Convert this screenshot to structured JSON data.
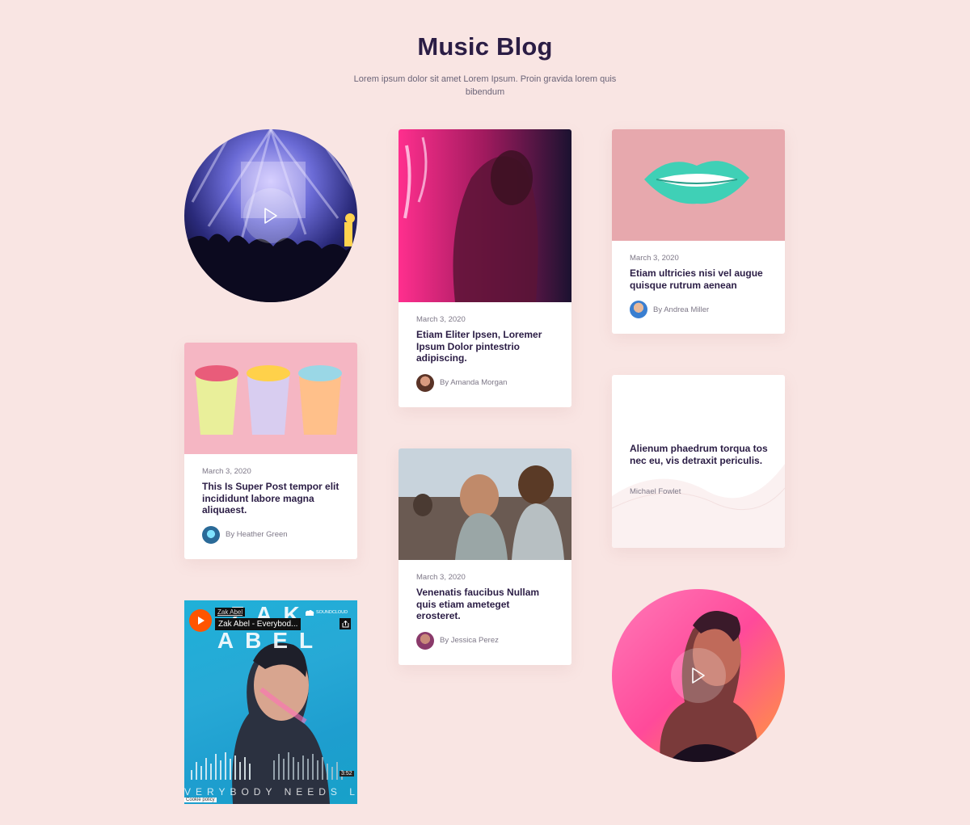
{
  "header": {
    "title": "Music Blog",
    "subtitle": "Lorem ipsum dolor sit amet Lorem Ipsum. Proin gravida lorem quis bibendum"
  },
  "posts": [
    {
      "date": "March 3, 2020",
      "title": "Etiam Eliter Ipsen, Loremer Ipsum Dolor pintestrio adipiscing.",
      "author": "By Amanda Morgan"
    },
    {
      "date": "March 3, 2020",
      "title": "Etiam ultricies nisi vel augue quisque rutrum aenean",
      "author": "By Andrea Miller"
    },
    {
      "date": "March 3, 2020",
      "title": "This Is Super Post tempor elit incididunt labore magna aliquaest.",
      "author": "By Heather Green"
    },
    {
      "date": "March 3, 2020",
      "title": "Venenatis faucibus Nullam quis etiam ameteget erosteret.",
      "author": "By Jessica Perez"
    }
  ],
  "quote": {
    "text": "Alienum phaedrum torqua tos nec eu, vis detraxit periculis.",
    "author": "Michael Fowlet"
  },
  "soundcloud": {
    "artist": "Zak Abel",
    "track": "Zak Abel - Everybod...",
    "brand": "SOUNDCLOUD",
    "cover_top": "ZAK ABEL",
    "cover_bottom": "VERYBODY NEEDS LOV",
    "duration": "3:52",
    "cookie": "Cookie policy"
  },
  "colors": {
    "background": "#f9e5e3",
    "title": "#2b1d45",
    "soundcloud": "#ff5500"
  },
  "icons": [
    "play-icon",
    "soundcloud-play-icon",
    "share-icon",
    "cloud-icon"
  ]
}
